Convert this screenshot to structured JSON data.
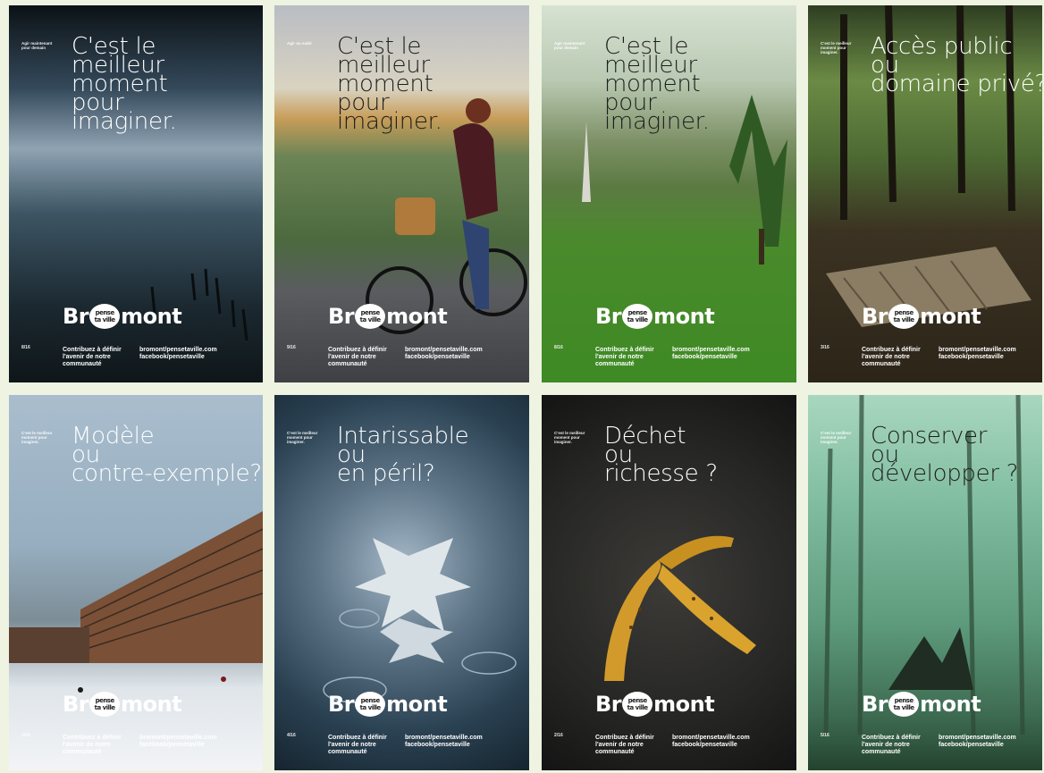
{
  "posters": [
    {
      "id": "p1",
      "headline": "C'est le\nmeilleur\nmoment\npour\nimaginer.",
      "small": "Agir maintenant pour demain",
      "page": "8/16",
      "colors": [
        "#1c2a33",
        "#5d7180",
        "#2a3a44"
      ]
    },
    {
      "id": "p2",
      "headline": "C'est le\nmeilleur\nmoment\npour\nimaginer.",
      "small": "Agir ou subir",
      "page": "9/16",
      "colors": [
        "#c8cbd1",
        "#6f8a5a",
        "#4a4c50"
      ]
    },
    {
      "id": "p3",
      "headline": "C'est le\nmeilleur\nmoment\npour\nimaginer.",
      "small": "Agir maintenant pour demain",
      "page": "8/16",
      "colors": [
        "#c8d6c3",
        "#7a9a6a",
        "#3f8a2b"
      ]
    },
    {
      "id": "p4",
      "headline": "Accès public\nou\ndomaine privé?",
      "small": "C'est le meilleur moment pour imaginer.",
      "page": "3/16",
      "colors": [
        "#3b4e2a",
        "#5c7a3c",
        "#2c2a1e"
      ]
    },
    {
      "id": "p5",
      "headline": "Modèle\nou\ncontre-exemple?",
      "small": "C'est le meilleur moment pour imaginer.",
      "page": "2/16",
      "colors": [
        "#9db2c4",
        "#7a5a44",
        "#e9edf0"
      ]
    },
    {
      "id": "p6",
      "headline": "Intarissable\nou\nen péril?",
      "small": "C'est le meilleur moment pour imaginer.",
      "page": "4/16",
      "colors": [
        "#203446",
        "#5b7384",
        "#2a3c4c"
      ]
    },
    {
      "id": "p7",
      "headline": "Déchet\nou\nrichesse ?",
      "small": "C'est le meilleur moment pour imaginer.",
      "page": "2/16",
      "colors": [
        "#222222",
        "#3a3a36",
        "#1a1a1a"
      ]
    },
    {
      "id": "p8",
      "headline": "Conserver\nou\ndévelopper ?",
      "small": "C'est le meilleur moment pour imaginer.",
      "page": "5/16",
      "colors": [
        "#7fb99c",
        "#5f9a7c",
        "#2f5a3c"
      ]
    }
  ],
  "brand": {
    "left": "Br",
    "bubble_top": "pense",
    "bubble_bottom": "ta ville",
    "right": "mont"
  },
  "tagline": "Contribuez à définir l'avenir de notre communauté",
  "links": [
    "bromont/pensetaville.com",
    "facebook/pensetaville"
  ]
}
